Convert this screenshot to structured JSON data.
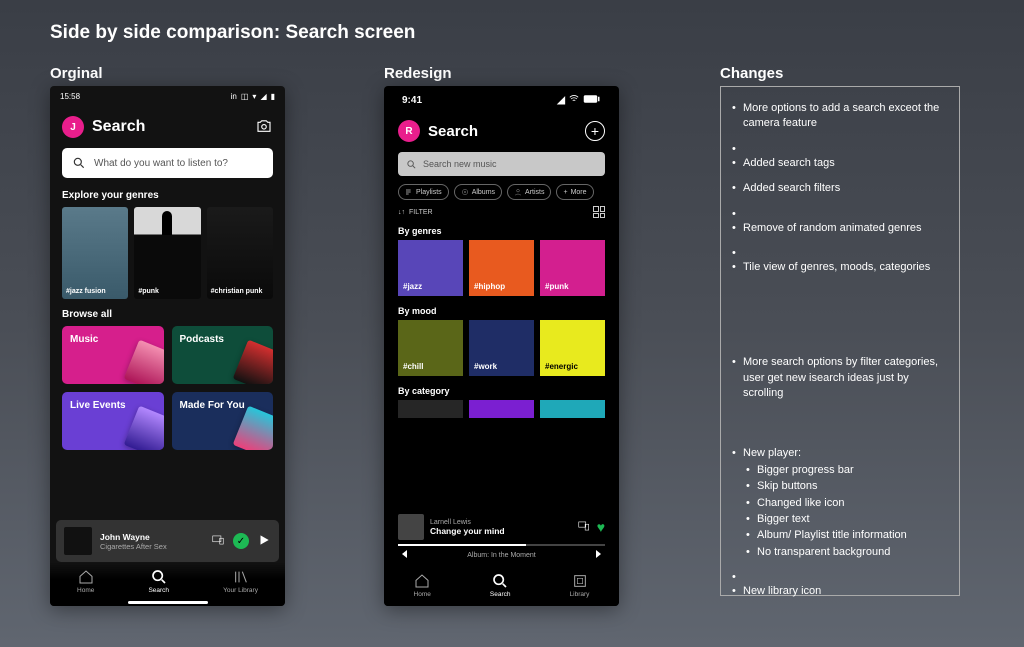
{
  "page": {
    "title": "Side by side comparison: Search screen"
  },
  "columns": {
    "original": "Orginal",
    "redesign": "Redesign",
    "changes": "Changes"
  },
  "original": {
    "statusbar": {
      "time": "15:58"
    },
    "avatar_initial": "J",
    "header_title": "Search",
    "search_placeholder": "What do you want to listen to?",
    "explore_label": "Explore your genres",
    "genres": [
      "#jazz fusion",
      "#punk",
      "#christian punk"
    ],
    "browse_label": "Browse all",
    "cards": {
      "music": "Music",
      "podcasts": "Podcasts",
      "live": "Live Events",
      "made": "Made For You"
    },
    "nowplaying": {
      "title": "John Wayne",
      "artist": "Cigarettes After Sex"
    },
    "nav": {
      "home": "Home",
      "search": "Search",
      "library": "Your Library"
    }
  },
  "redesign": {
    "statusbar": {
      "time": "9:41"
    },
    "avatar_initial": "R",
    "header_title": "Search",
    "search_placeholder": "Search new music",
    "chips": {
      "playlists": "Playlists",
      "albums": "Albums",
      "artists": "Artists",
      "more": "More"
    },
    "filter_label": "FILTER",
    "sections": {
      "genres": {
        "label": "By genres",
        "tiles": [
          "#jazz",
          "#hiphop",
          "#punk"
        ]
      },
      "mood": {
        "label": "By mood",
        "tiles": [
          "#chill",
          "#work",
          "#energic"
        ]
      },
      "category": {
        "label": "By category"
      }
    },
    "nowplaying": {
      "artist": "Larnell Lewis",
      "title": "Change your mind",
      "album_line": "Album: In the Moment"
    },
    "nav": {
      "home": "Home",
      "search": "Search",
      "library": "Library"
    }
  },
  "changes": {
    "items": [
      "More options to add a search exceot the camera feature",
      "Added search tags",
      "Added search filters",
      "Remove of random animated genres",
      "Tile view of genres, moods, categories",
      "More search options by filter categories, user get new isearch ideas just by scrolling"
    ],
    "player_title": "New player:",
    "player_items": [
      "Bigger progress bar",
      "Skip buttons",
      "Changed like icon",
      "Bigger text",
      "Album/ Playlist title information",
      "No transparent background"
    ],
    "last": "New library icon"
  }
}
